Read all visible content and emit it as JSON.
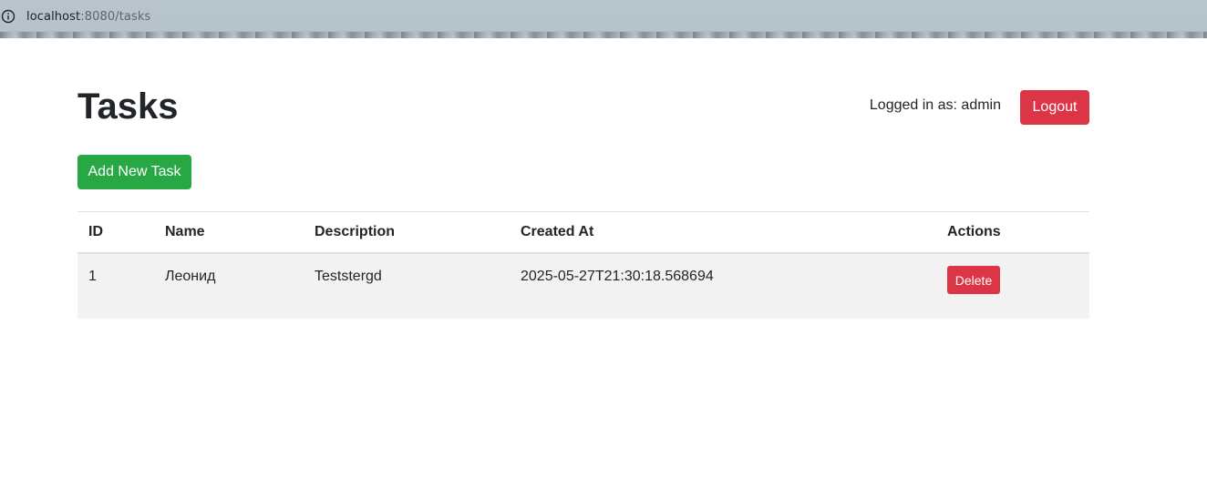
{
  "browser": {
    "url_host": "localhost",
    "url_rest": ":8080/tasks",
    "info_icon": "info-icon"
  },
  "header": {
    "title": "Tasks",
    "logged_in_text": "Logged in as: admin",
    "logout_label": "Logout"
  },
  "toolbar": {
    "add_label": "Add New Task"
  },
  "table": {
    "columns": [
      "ID",
      "Name",
      "Description",
      "Created At",
      "Actions"
    ],
    "rows": [
      {
        "id": "1",
        "name": "Леонид",
        "description": "Teststergd",
        "created_at": "2025-05-27T21:30:18.568694",
        "delete_label": "Delete"
      }
    ]
  },
  "colors": {
    "danger": "#dc3545",
    "success": "#28a745",
    "row_bg": "#f2f2f2"
  }
}
